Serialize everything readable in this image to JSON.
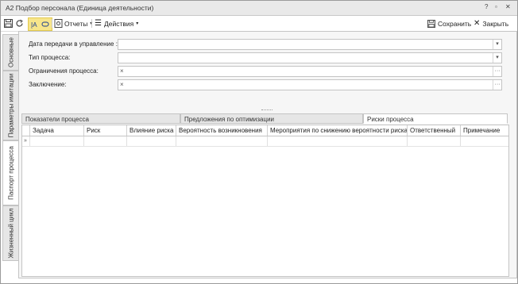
{
  "window": {
    "title": "A2 Подбор персонала (Единица деятельности)",
    "controls": [
      "?",
      "▫",
      "✕"
    ]
  },
  "toolbar": {
    "reports": "Отчеты",
    "actions": "Действия",
    "save": "Сохранить",
    "close": "Закрыть"
  },
  "side_tabs": [
    "Основные",
    "Параметры имитации",
    "Паспорт процесса",
    "Жизненный цикл"
  ],
  "fields": [
    {
      "label": "Дата передачи в управление :",
      "value": "",
      "button": "▾"
    },
    {
      "label": "Тип процесса:",
      "value": "",
      "button": "▾"
    },
    {
      "label": "Ограничения процесса:",
      "value": "",
      "clear": "×",
      "button": "···"
    },
    {
      "label": "Заключение:",
      "value": "",
      "clear": "×",
      "button": "···"
    }
  ],
  "bottom_tabs": [
    "Показатели процесса",
    "Предложения по оптимизации",
    "Риски процесса"
  ],
  "grid": {
    "columns": [
      "Задача",
      "Риск",
      "Влияние риска",
      "Вероятность возникновения",
      "Мероприятия по снижению вероятности риска",
      "Ответственный",
      "Примечание"
    ],
    "row_indicator": "»"
  }
}
